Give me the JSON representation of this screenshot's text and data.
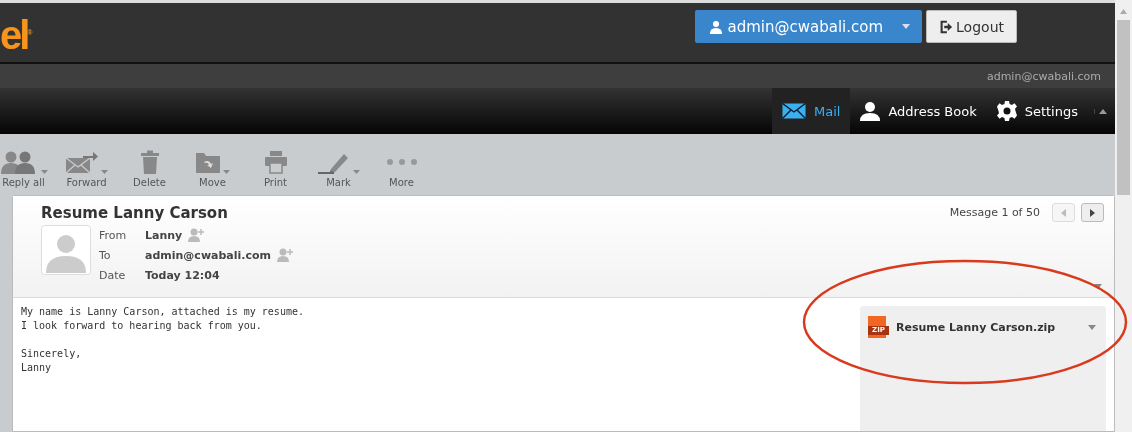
{
  "logo": "el$^{®}$",
  "user_menu": {
    "label": "admin@cwabali.com"
  },
  "logout_button": {
    "label": "Logout"
  },
  "account_label": "admin@cwabali.com",
  "nav_tabs": [
    {
      "label": "Mail",
      "kind": "mail",
      "selected": true
    },
    {
      "label": "Address Book",
      "kind": "contacts",
      "selected": false
    },
    {
      "label": "Settings",
      "kind": "settings",
      "selected": false
    }
  ],
  "toolbar": [
    {
      "label": "Reply all",
      "kind": "reply-all",
      "has_menu": true
    },
    {
      "label": "Forward",
      "kind": "forward",
      "has_menu": true
    },
    {
      "label": "Delete",
      "kind": "delete",
      "has_menu": false
    },
    {
      "label": "Move",
      "kind": "move",
      "has_menu": true
    },
    {
      "label": "Print",
      "kind": "print",
      "has_menu": false
    },
    {
      "label": "Mark",
      "kind": "mark",
      "has_menu": true
    },
    {
      "label": "More",
      "kind": "more",
      "has_menu": false
    }
  ],
  "message": {
    "subject": "Resume Lanny Carson",
    "counter": "Message 1 of 50",
    "prev_disabled": true,
    "headers": [
      {
        "label": "From",
        "value": "Lanny",
        "add_contact": true
      },
      {
        "label": "To",
        "value": "admin@cwabali.com",
        "add_contact": true
      },
      {
        "label": "Date",
        "value": "Today 12:04",
        "add_contact": false
      }
    ],
    "body": [
      [
        "My name is Lanny Carson, attached is my resume.",
        "I look forward to hearing back from you."
      ],
      [
        "Sincerely,",
        "Lanny"
      ]
    ],
    "attachments": [
      {
        "name": "Resume Lanny Carson.zip",
        "badge": "ZIP"
      }
    ]
  }
}
